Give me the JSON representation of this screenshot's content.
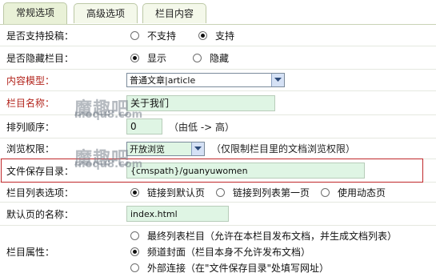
{
  "tabs": [
    {
      "label": "常规选项",
      "active": true
    },
    {
      "label": "高级选项",
      "active": false
    },
    {
      "label": "栏目内容",
      "active": false
    }
  ],
  "form": {
    "allow_submit": {
      "label": "是否支持投稿：",
      "options": [
        "不支持",
        "支持"
      ],
      "selected": "支持"
    },
    "hidden": {
      "label": "是否隐藏栏目：",
      "options": [
        "显示",
        "隐藏"
      ],
      "selected": "显示"
    },
    "content_model": {
      "label": "内容模型：",
      "value": "普通文章|article"
    },
    "column_name": {
      "label": "栏目名称：",
      "value": "关于我们"
    },
    "sort_order": {
      "label": "排列顺序：",
      "value": "0",
      "hint": "（由低 -> 高）"
    },
    "browse_permission": {
      "label": "浏览权限：",
      "value": "开放浏览",
      "hint": "（仅限制栏目里的文档浏览权限）"
    },
    "save_dir": {
      "label": "文件保存目录：",
      "value": "{cmspath}/guanyuwomen"
    },
    "list_option": {
      "label": "栏目列表选项：",
      "options": [
        "链接到默认页",
        "链接到列表第一页",
        "使用动态页"
      ],
      "selected": "链接到默认页"
    },
    "default_page": {
      "label": "默认页的名称：",
      "value": "index.html"
    },
    "attributes": {
      "label": "栏目属性：",
      "options": [
        "最终列表栏目（允许在本栏目发布文档，并生成文档列表）",
        "频道封面（栏目本身不允许发布文档）",
        "外部连接（在\"文件保存目录\"处填写网址）"
      ],
      "selected": "频道封面（栏目本身不允许发布文档）"
    }
  },
  "watermark": {
    "cn": "魔趣吧",
    "en": "moqu8.com"
  },
  "colors": {
    "field_bg": "#dff5e4",
    "label_red": "#b3251d",
    "highlight_border": "#c0282b"
  }
}
